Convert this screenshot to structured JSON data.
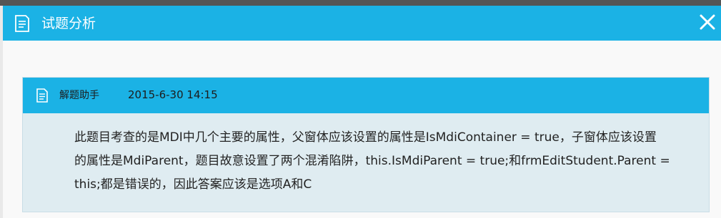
{
  "dialog": {
    "title": "试题分析",
    "close_label": "×"
  },
  "analysis": {
    "author": "解题助手",
    "time": "2015-6-30 14:15",
    "lines": [
      "此题目考查的是MDI中几个主要的属性，父窗体应该设置的属性是IsMdiContainer = true，子窗体应该设置",
      "的属性是MdiParent，题目故意设置了两个混淆陷阱，this.IsMdiParent = true;和frmEditStudent.Parent =",
      "this;都是错误的，因此答案应该是选项A和C"
    ]
  },
  "colors": {
    "accent": "#1bb2e5",
    "panel_bg": "#dfecf1"
  },
  "icons": {
    "title_icon": "document-icon",
    "close_icon": "close-icon",
    "panel_icon": "document-icon"
  }
}
